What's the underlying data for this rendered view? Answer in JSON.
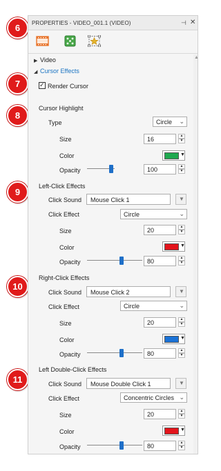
{
  "panel": {
    "title": "PROPERTIES - VIDEO_001.1 (VIDEO)",
    "pin_glyph": "⊣",
    "close_glyph": "✕"
  },
  "tabs": [
    {
      "icon": "film-strip-icon",
      "selected": true
    },
    {
      "icon": "dice-icon",
      "selected": false
    },
    {
      "icon": "star-frame-icon",
      "selected": false
    }
  ],
  "sections": {
    "video": "Video",
    "cursor_effects": "Cursor Effects"
  },
  "render_cursor": {
    "label": "Render Cursor",
    "checked": true
  },
  "cursor_highlight": {
    "heading": "Cursor Highlight",
    "type_label": "Type",
    "type_value": "Circle",
    "size_label": "Size",
    "size_value": "16",
    "color_label": "Color",
    "color_value": "#1fa84f",
    "opacity_label": "Opacity",
    "opacity_value": "100",
    "opacity_fraction": 1.0
  },
  "left_click": {
    "heading": "Left-Click Effects",
    "sound_label": "Click Sound",
    "sound_value": "Mouse Click 1",
    "effect_label": "Click Effect",
    "effect_value": "Circle",
    "size_label": "Size",
    "size_value": "20",
    "color_label": "Color",
    "color_value": "#e3141b",
    "opacity_label": "Opacity",
    "opacity_value": "80",
    "opacity_fraction": 0.8
  },
  "right_click": {
    "heading": "Right-Click Effects",
    "sound_label": "Click Sound",
    "sound_value": "Mouse Click 2",
    "effect_label": "Click Effect",
    "effect_value": "Circle",
    "size_label": "Size",
    "size_value": "20",
    "color_label": "Color",
    "color_value": "#1a72d6",
    "opacity_label": "Opacity",
    "opacity_value": "80",
    "opacity_fraction": 0.8
  },
  "left_double_click": {
    "heading": "Left Double-Click Effects",
    "sound_label": "Click Sound",
    "sound_value": "Mouse Double Click 1",
    "effect_label": "Click Effect",
    "effect_value": "Concentric Circles",
    "size_label": "Size",
    "size_value": "20",
    "color_label": "Color",
    "color_value": "#e3141b",
    "opacity_label": "Opacity",
    "opacity_value": "80",
    "opacity_fraction": 0.8
  },
  "markers": [
    "6",
    "7",
    "8",
    "9",
    "10",
    "11"
  ],
  "colors": {
    "accent": "#1b74c2",
    "marker_red": "#e01b1b",
    "tab_orange": "#e8732a",
    "tab_green": "#4aa84a",
    "tab_gold": "#e5b52c"
  }
}
